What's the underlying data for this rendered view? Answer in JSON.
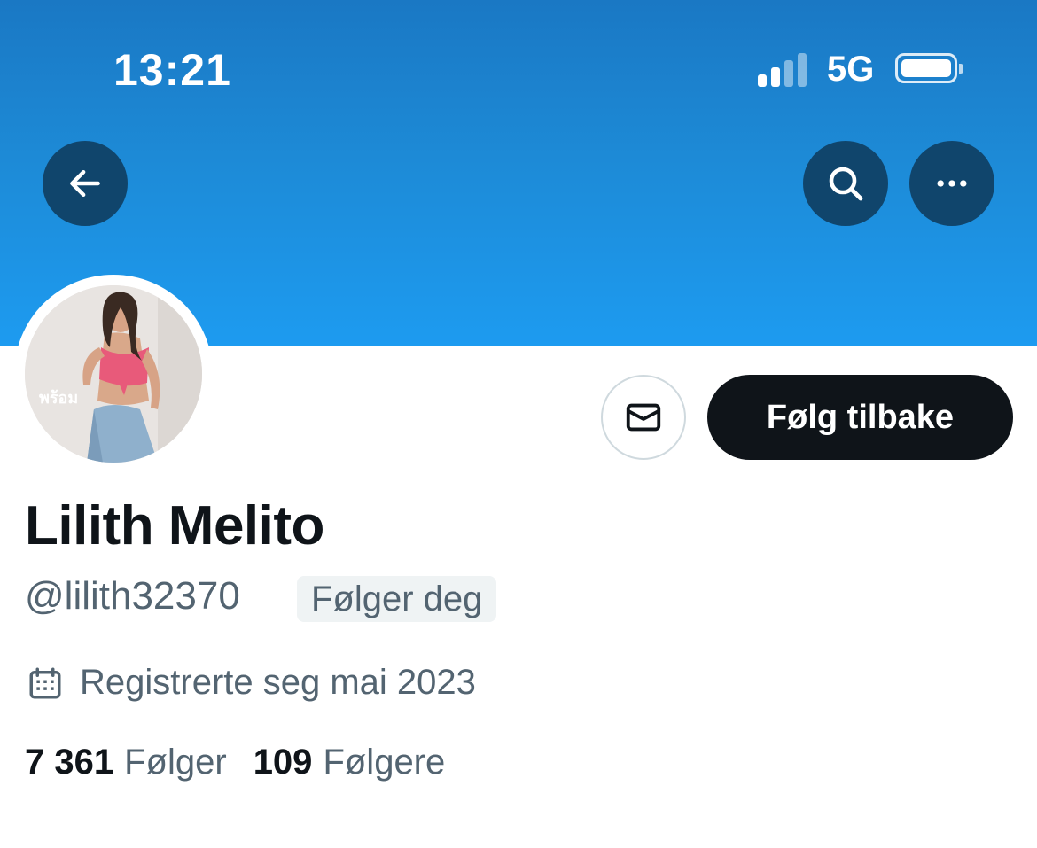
{
  "status_bar": {
    "time": "13:21",
    "network": "5G",
    "signal_bars_active": 2,
    "signal_bars_total": 4
  },
  "colors": {
    "banner_top": "#1a78c4",
    "banner_bottom": "#1d9bf0",
    "nav_button": "#10456c",
    "primary_text": "#0f1419",
    "secondary_text": "#536471",
    "badge_bg": "#eff3f4"
  },
  "nav": {
    "back_icon": "arrow-left-icon",
    "search_icon": "search-icon",
    "more_icon": "more-horizontal-icon"
  },
  "avatar": {
    "overlay_text": "พร้อม"
  },
  "actions": {
    "message_icon": "mail-icon",
    "follow_button_label": "Følg tilbake"
  },
  "profile": {
    "display_name": "Lilith Melito",
    "handle": "@lilith32370",
    "follows_you_badge": "Følger deg",
    "joined_icon": "calendar-icon",
    "joined_text": "Registrerte seg mai 2023"
  },
  "stats": {
    "following_count": "7 361",
    "following_label": "Følger",
    "followers_count": "109",
    "followers_label": "Følgere"
  }
}
